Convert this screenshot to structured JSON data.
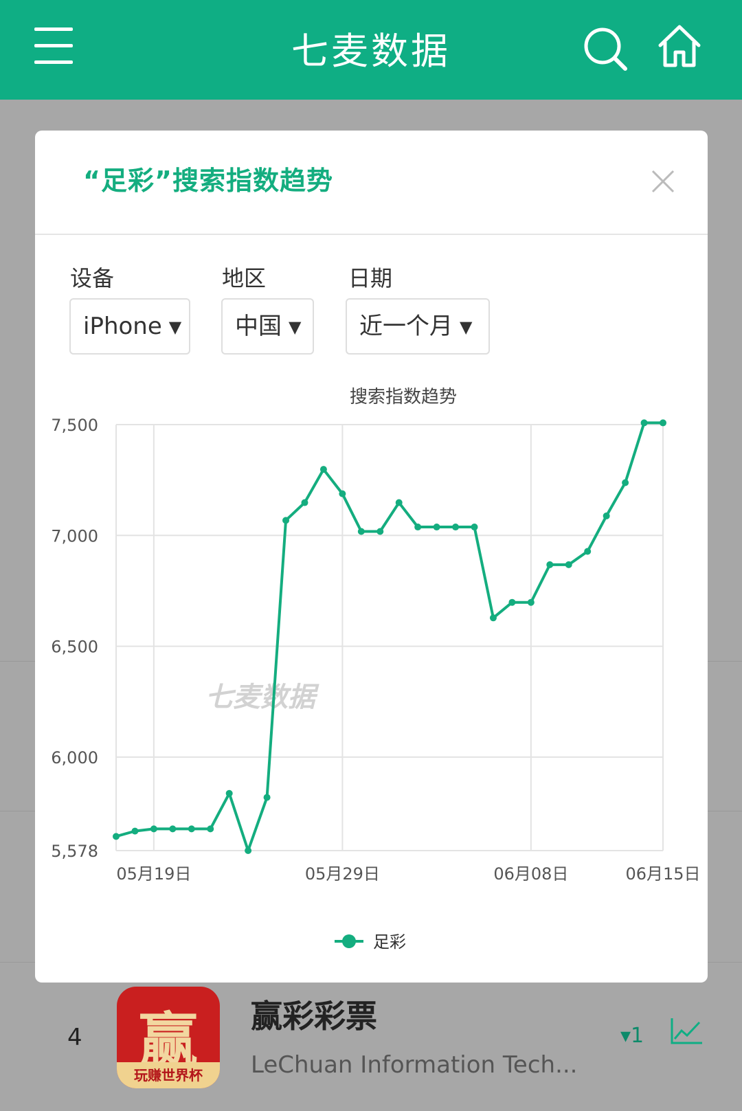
{
  "header": {
    "title": "七麦数据",
    "menu_icon": "hamburger-menu-icon",
    "search_icon": "search-icon",
    "home_icon": "home-icon",
    "bar_color": "#0fae84"
  },
  "modal": {
    "title": "“足彩”搜索指数趋势",
    "close_icon": "close-icon",
    "filters": [
      {
        "label": "设备",
        "value": "iPhone"
      },
      {
        "label": "地区",
        "value": "中国"
      },
      {
        "label": "日期",
        "value": "近一个月"
      }
    ]
  },
  "chart_data": {
    "type": "line",
    "title": "搜索指数趋势",
    "watermark": "七麦数据",
    "x_ticks": [
      "05月19日",
      "05月29日",
      "06月08日",
      "06月15日"
    ],
    "y_ticks": [
      "7,500",
      "7,000",
      "6,500",
      "6,000",
      "5,578"
    ],
    "ylim": [
      5578,
      7500
    ],
    "grid": true,
    "legend_position": "bottom",
    "color": "#14ad7f",
    "x": [
      "05月17日",
      "05月18日",
      "05月19日",
      "05月20日",
      "05月21日",
      "05月22日",
      "05月23日",
      "05月24日",
      "05月25日",
      "05月26日",
      "05月27日",
      "05月28日",
      "05月29日",
      "05月30日",
      "05月31日",
      "06月01日",
      "06月02日",
      "06月03日",
      "06月04日",
      "06月05日",
      "06月06日",
      "06月07日",
      "06月08日",
      "06月09日",
      "06月10日",
      "06月11日",
      "06月12日",
      "06月13日",
      "06月14日",
      "06月15日"
    ],
    "series": [
      {
        "name": "足彩",
        "values": [
          5642,
          5666,
          5676,
          5676,
          5676,
          5676,
          5836,
          5578,
          5818,
          7068,
          7148,
          7298,
          7188,
          7018,
          7018,
          7148,
          7038,
          7038,
          7038,
          7038,
          6628,
          6698,
          6698,
          6868,
          6868,
          6928,
          7088,
          7238,
          7508,
          7508
        ]
      }
    ]
  },
  "list_row": {
    "rank": "4",
    "name": "赢彩彩票",
    "developer": "LeChuan Information Tech...",
    "change": "▾1",
    "icon_glyph": "赢",
    "icon_banner": "玩赚世界杯",
    "trend_icon": "trend-chart-icon"
  }
}
